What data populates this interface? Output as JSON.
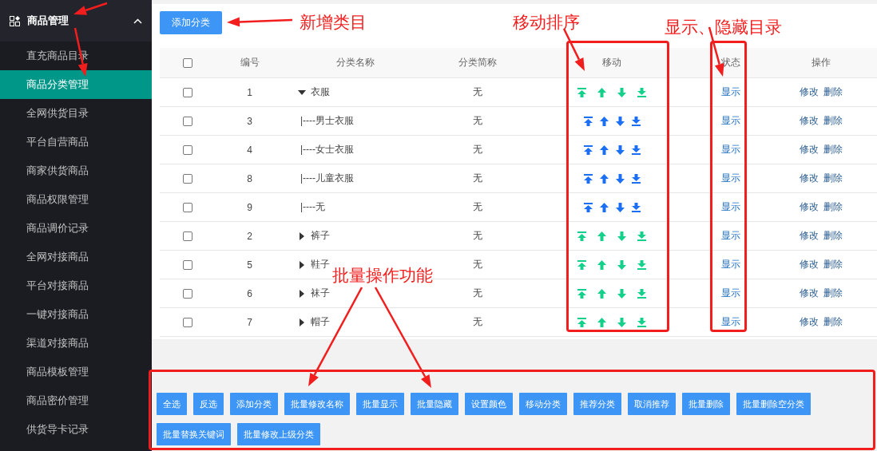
{
  "sidebar": {
    "group": {
      "label": "商品管理",
      "expanded": true
    },
    "items": [
      {
        "label": "直充商品目录",
        "selected": false
      },
      {
        "label": "商品分类管理",
        "selected": true
      },
      {
        "label": "全网供货目录",
        "selected": false
      },
      {
        "label": "平台自营商品",
        "selected": false
      },
      {
        "label": "商家供货商品",
        "selected": false
      },
      {
        "label": "商品权限管理",
        "selected": false
      },
      {
        "label": "商品调价记录",
        "selected": false
      },
      {
        "label": "全网对接商品",
        "selected": false
      },
      {
        "label": "平台对接商品",
        "selected": false
      },
      {
        "label": "一键对接商品",
        "selected": false
      },
      {
        "label": "渠道对接商品",
        "selected": false
      },
      {
        "label": "商品模板管理",
        "selected": false
      },
      {
        "label": "商品密价管理",
        "selected": false
      },
      {
        "label": "供货导卡记录",
        "selected": false
      }
    ]
  },
  "add_button": "添加分类",
  "table": {
    "columns": [
      "编号",
      "分类名称",
      "分类简称",
      "移动",
      "状态",
      "操作"
    ],
    "header_checked": false,
    "rows": [
      {
        "kind": "parent",
        "expanded": true,
        "checked": false,
        "id": "1",
        "name": "衣服",
        "short": "无",
        "status": "显示",
        "actions": [
          "修改",
          "删除"
        ]
      },
      {
        "kind": "child",
        "checked": false,
        "id": "3",
        "name": "|----男士衣服",
        "short": "无",
        "status": "显示",
        "actions": [
          "修改",
          "删除"
        ]
      },
      {
        "kind": "child",
        "checked": false,
        "id": "4",
        "name": "|----女士衣服",
        "short": "无",
        "status": "显示",
        "actions": [
          "修改",
          "删除"
        ]
      },
      {
        "kind": "child",
        "checked": false,
        "id": "8",
        "name": "|----儿童衣服",
        "short": "无",
        "status": "显示",
        "actions": [
          "修改",
          "删除"
        ]
      },
      {
        "kind": "child",
        "checked": false,
        "id": "9",
        "name": "|----无",
        "short": "无",
        "status": "显示",
        "actions": [
          "修改",
          "删除"
        ]
      },
      {
        "kind": "parent",
        "expanded": false,
        "checked": false,
        "id": "2",
        "name": "裤子",
        "short": "无",
        "status": "显示",
        "actions": [
          "修改",
          "删除"
        ]
      },
      {
        "kind": "parent",
        "expanded": false,
        "checked": false,
        "id": "5",
        "name": "鞋子",
        "short": "无",
        "status": "显示",
        "actions": [
          "修改",
          "删除"
        ]
      },
      {
        "kind": "parent",
        "expanded": false,
        "checked": false,
        "id": "6",
        "name": "袜子",
        "short": "无",
        "status": "显示",
        "actions": [
          "修改",
          "删除"
        ]
      },
      {
        "kind": "parent",
        "expanded": false,
        "checked": false,
        "id": "7",
        "name": "帽子",
        "short": "无",
        "status": "显示",
        "actions": [
          "修改",
          "删除"
        ]
      }
    ]
  },
  "bulk_buttons": [
    "全选",
    "反选",
    "添加分类",
    "批量修改名称",
    "批量显示",
    "批量隐藏",
    "设置颜色",
    "移动分类",
    "推荐分类",
    "取消推荐",
    "批量删除",
    "批量删除空分类",
    "批量替换关键词",
    "批量修改上级分类"
  ],
  "annotations": [
    "新增类目",
    "移动排序",
    "显示、隐藏目录",
    "批量操作功能"
  ]
}
